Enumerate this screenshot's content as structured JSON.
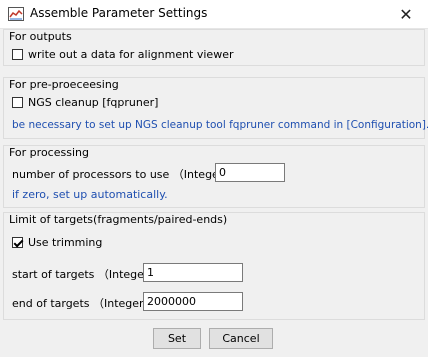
{
  "window": {
    "title": "Assemble Parameter Settings",
    "close_glyph": "✕"
  },
  "outputs": {
    "title": "For outputs",
    "alignment_viewer": {
      "label": "write out a data for alignment viewer",
      "checked": false
    }
  },
  "preprocessing": {
    "title": "For pre-proeceesing",
    "ngs_cleanup": {
      "label": "NGS cleanup [fqpruner]",
      "checked": false
    },
    "note": "be necessary to set up NGS cleanup tool fqpruner command in [Configuration]."
  },
  "processing": {
    "title": "For processing",
    "processors_label": "number of processors to use （Integer）",
    "processors_value": "0",
    "note": "if zero, set up automatically."
  },
  "targets": {
    "title": "Limit of targets(fragments/paired-ends)",
    "use_trimming": {
      "label": "Use trimming",
      "checked": true
    },
    "start_label": "start of targets （Integer）",
    "start_value": "1",
    "end_label": "end of targets （Integer）",
    "end_value": "2000000"
  },
  "buttons": {
    "set": "Set",
    "cancel": "Cancel"
  },
  "colors": {
    "note_blue": "#1f4fb0",
    "background": "#f0f0f0"
  }
}
